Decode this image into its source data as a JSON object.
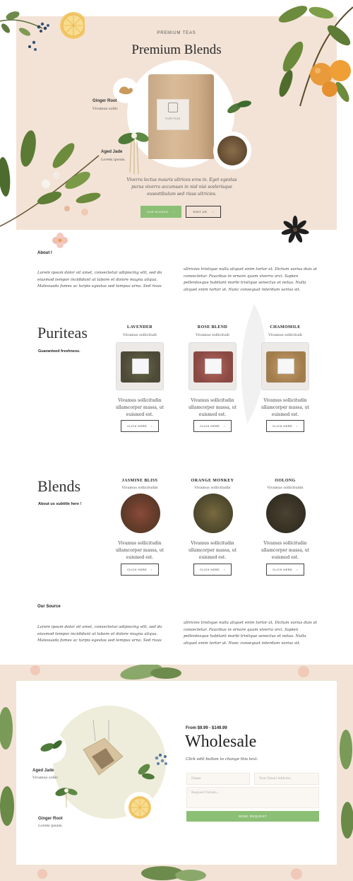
{
  "hero": {
    "eyebrow": "PREMIUM TEAS",
    "title": "Premium Blends",
    "ingredient_1": {
      "name": "Ginger Root",
      "sub": "Vivamus sollic"
    },
    "ingredient_2": {
      "name": "Aged Jade",
      "sub": "Lorem ipsum."
    },
    "description": "Viverra lectus mauris ultrices eros in. Eget egestas purus viverra accumsan in nisl nisi scelerisque eusestibulum sed risus ultricies.",
    "primary_button": "OUR BLENDS",
    "secondary_button": "VISIT US",
    "button_arrow": "›",
    "tea_bag_label": "PURITEAS"
  },
  "about": {
    "label": "About l",
    "col1": "Lorem ipsum dolor sit amet, consectetur adipiscing elit, sed do eiusmod tempor incididunt ut labore et dolore magna aliqua. Malesuada fames ac turpis egestas sed tempus urna. Sed risus",
    "col2": "ultricies tristique nulla aliquet enim tortor at. Dictum varius duis at consectetur. Faucibus in ornare quam viverra orci. Sapien pellentesque habitant morbi tristique senectus et netus. Nulla aliquet enim tortor at. Nunc consequat interdum varius sit."
  },
  "puriteas": {
    "title": "Puriteas",
    "subtitle": "Guaranteed freshness.",
    "products": [
      {
        "name": "LAVENDER",
        "sub": "Vivamus sollicitudi",
        "desc": "Vivamus sollicitudin ullamcorper massa, ut euismod est.",
        "button": "CLICK HERE"
      },
      {
        "name": "ROSE BLEND",
        "sub": "Vivamus sollicitudi",
        "desc": "Vivamus sollicitudin ullamcorper massa, ut euismod est.",
        "button": "CLICK HERE"
      },
      {
        "name": "CHAMOMILE",
        "sub": "Vivamus sollicitudi",
        "desc": "Vivamus sollicitudin ullamcorper massa, ut euismod est.",
        "button": "CLICK HERE"
      }
    ]
  },
  "blends": {
    "title": "Blends",
    "subtitle": "About us subtitle here !",
    "products": [
      {
        "name": "JASMINE BLISS",
        "sub": "Vivamus sollicitudin",
        "desc": "Vivamus sollicitudin ullamcorper massa, ut euismod est.",
        "button": "CLICK HERE"
      },
      {
        "name": "ORANGE MONKEY",
        "sub": "Vivamus sollicitudin",
        "desc": "Vivamus sollicitudin ullamcorper massa, ut euismod est.",
        "button": "CLICK HERE"
      },
      {
        "name": "OOLONG",
        "sub": "Vivamus sollicitudin",
        "desc": "Vivamus sollicitudin ullamcorper massa, ut euismod est.",
        "button": "CLICK HERE"
      }
    ]
  },
  "source": {
    "label": "Our Source",
    "col1": "Lorem ipsum dolor sit amet, consectetur adipiscing elit, sed do eiusmod tempor incididunt ut labore et dolore magna aliqua. Malesuada fames ac turpis egestas sed tempus urna. Sed risus",
    "col2": "ultricies tristique nulla aliquet enim tortor at. Dictum varius duis at consectetur. Faucibus in ornare quam viverra orci. Sapien pellentesque habitant morbi tristique senectus et netus. Nulla aliquet enim tortor at. Nunc consequat interdum varius sit."
  },
  "wholesale": {
    "price": "From $9.99 - $149.99",
    "title": "Wholesale",
    "text": "Click edit button to change this text.",
    "name_placeholder": "Name",
    "email_placeholder": "Your Email Address",
    "details_placeholder": "Request Details...",
    "send_button": "SEND REQUEST",
    "ingredient_1": {
      "name": "Aged Jade",
      "sub": "Vivamus sollic"
    },
    "ingredient_2": {
      "name": "Ginger Root",
      "sub": "Lorem ipsum."
    }
  },
  "colors": {
    "accent_green": "#8bbf75",
    "hero_bg": "#f3e3d6",
    "wholesale_circle": "#eeeddb"
  }
}
